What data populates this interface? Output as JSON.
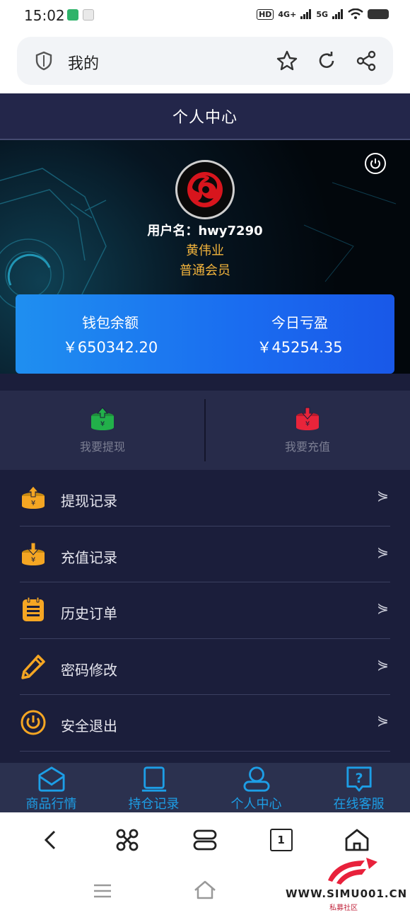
{
  "status_bar": {
    "time": "15:02",
    "network_label": "HD",
    "signal_1": "4G+",
    "signal_2": "5G"
  },
  "browser": {
    "address_text": "我的"
  },
  "header": {
    "title": "个人中心"
  },
  "profile": {
    "username_label": "用户名：",
    "username": "hwy7290",
    "real_name": "黄伟业",
    "member_level": "普通会员"
  },
  "balance": {
    "wallet_label": "钱包余额",
    "wallet_value": "￥650342.20",
    "today_label": "今日亏盈",
    "today_value": "￥45254.35"
  },
  "actions": [
    {
      "label": "我要提现",
      "icon": "withdraw-icon",
      "color": "#22b04a"
    },
    {
      "label": "我要充值",
      "icon": "deposit-icon",
      "color": "#e8243a"
    }
  ],
  "menu": [
    {
      "label": "提现记录",
      "icon": "withdraw-record-icon",
      "arrow": "⋟"
    },
    {
      "label": "充值记录",
      "icon": "deposit-record-icon",
      "arrow": "⋟"
    },
    {
      "label": "历史订单",
      "icon": "order-history-icon",
      "arrow": "⋟"
    },
    {
      "label": "密码修改",
      "icon": "pencil-icon",
      "arrow": "⋟"
    },
    {
      "label": "安全退出",
      "icon": "power-icon",
      "arrow": "⋟"
    }
  ],
  "tabs": [
    {
      "label": "商品行情",
      "icon": "market-icon"
    },
    {
      "label": "持仓记录",
      "icon": "holdings-icon"
    },
    {
      "label": "个人中心",
      "icon": "profile-icon"
    },
    {
      "label": "在线客服",
      "icon": "support-icon"
    }
  ],
  "browser_nav": {
    "tab_count": "1"
  },
  "watermark": {
    "site": "WWW.SIMU001.CN",
    "sub": "私募社区"
  },
  "colors": {
    "accent_gold": "#f3b43c",
    "accent_blue": "#1d9ee6",
    "page_bg": "#1b1e3b"
  }
}
